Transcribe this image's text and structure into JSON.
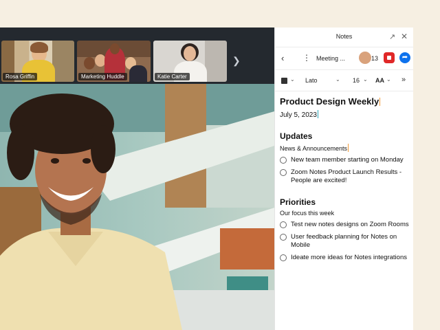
{
  "participants": [
    {
      "name": "Rosa Griffin",
      "label": "Rosa Griffin"
    },
    {
      "name": "Marketing Huddle",
      "label": "Marketing Huddle"
    },
    {
      "name": "Katie Carter",
      "label": "Katie Carter"
    }
  ],
  "notes_panel": {
    "title": "Notes",
    "doc_title_short": "Meeting ...",
    "participant_count": "13",
    "font_name": "Lato",
    "font_size": "16",
    "text_size_label": "AA"
  },
  "document": {
    "title": "Product Design Weekly",
    "date": "July 5, 2023",
    "sections": [
      {
        "heading": "Updates",
        "subheading": "News & Announcements",
        "items": [
          "New team member starting on Monday",
          "Zoom Notes Product Launch Results - People are excited!"
        ]
      },
      {
        "heading": "Priorities",
        "subheading": "Our focus this week",
        "items": [
          "Test new notes designs on Zoom Rooms",
          "User feedback planning for Notes on Mobile",
          "Ideate more ideas for Notes integrations"
        ]
      }
    ]
  },
  "colors": {
    "accent_blue": "#0e72ed",
    "record_red": "#e02828",
    "caret_orange": "#f29a38",
    "caret_teal": "#2aa6b8"
  },
  "icons": [
    "chevron-right-icon",
    "chevron-left-icon",
    "more-vertical-icon",
    "record-icon",
    "share-icon",
    "popout-icon",
    "close-icon",
    "chevron-down-icon",
    "double-chevron-right-icon"
  ]
}
